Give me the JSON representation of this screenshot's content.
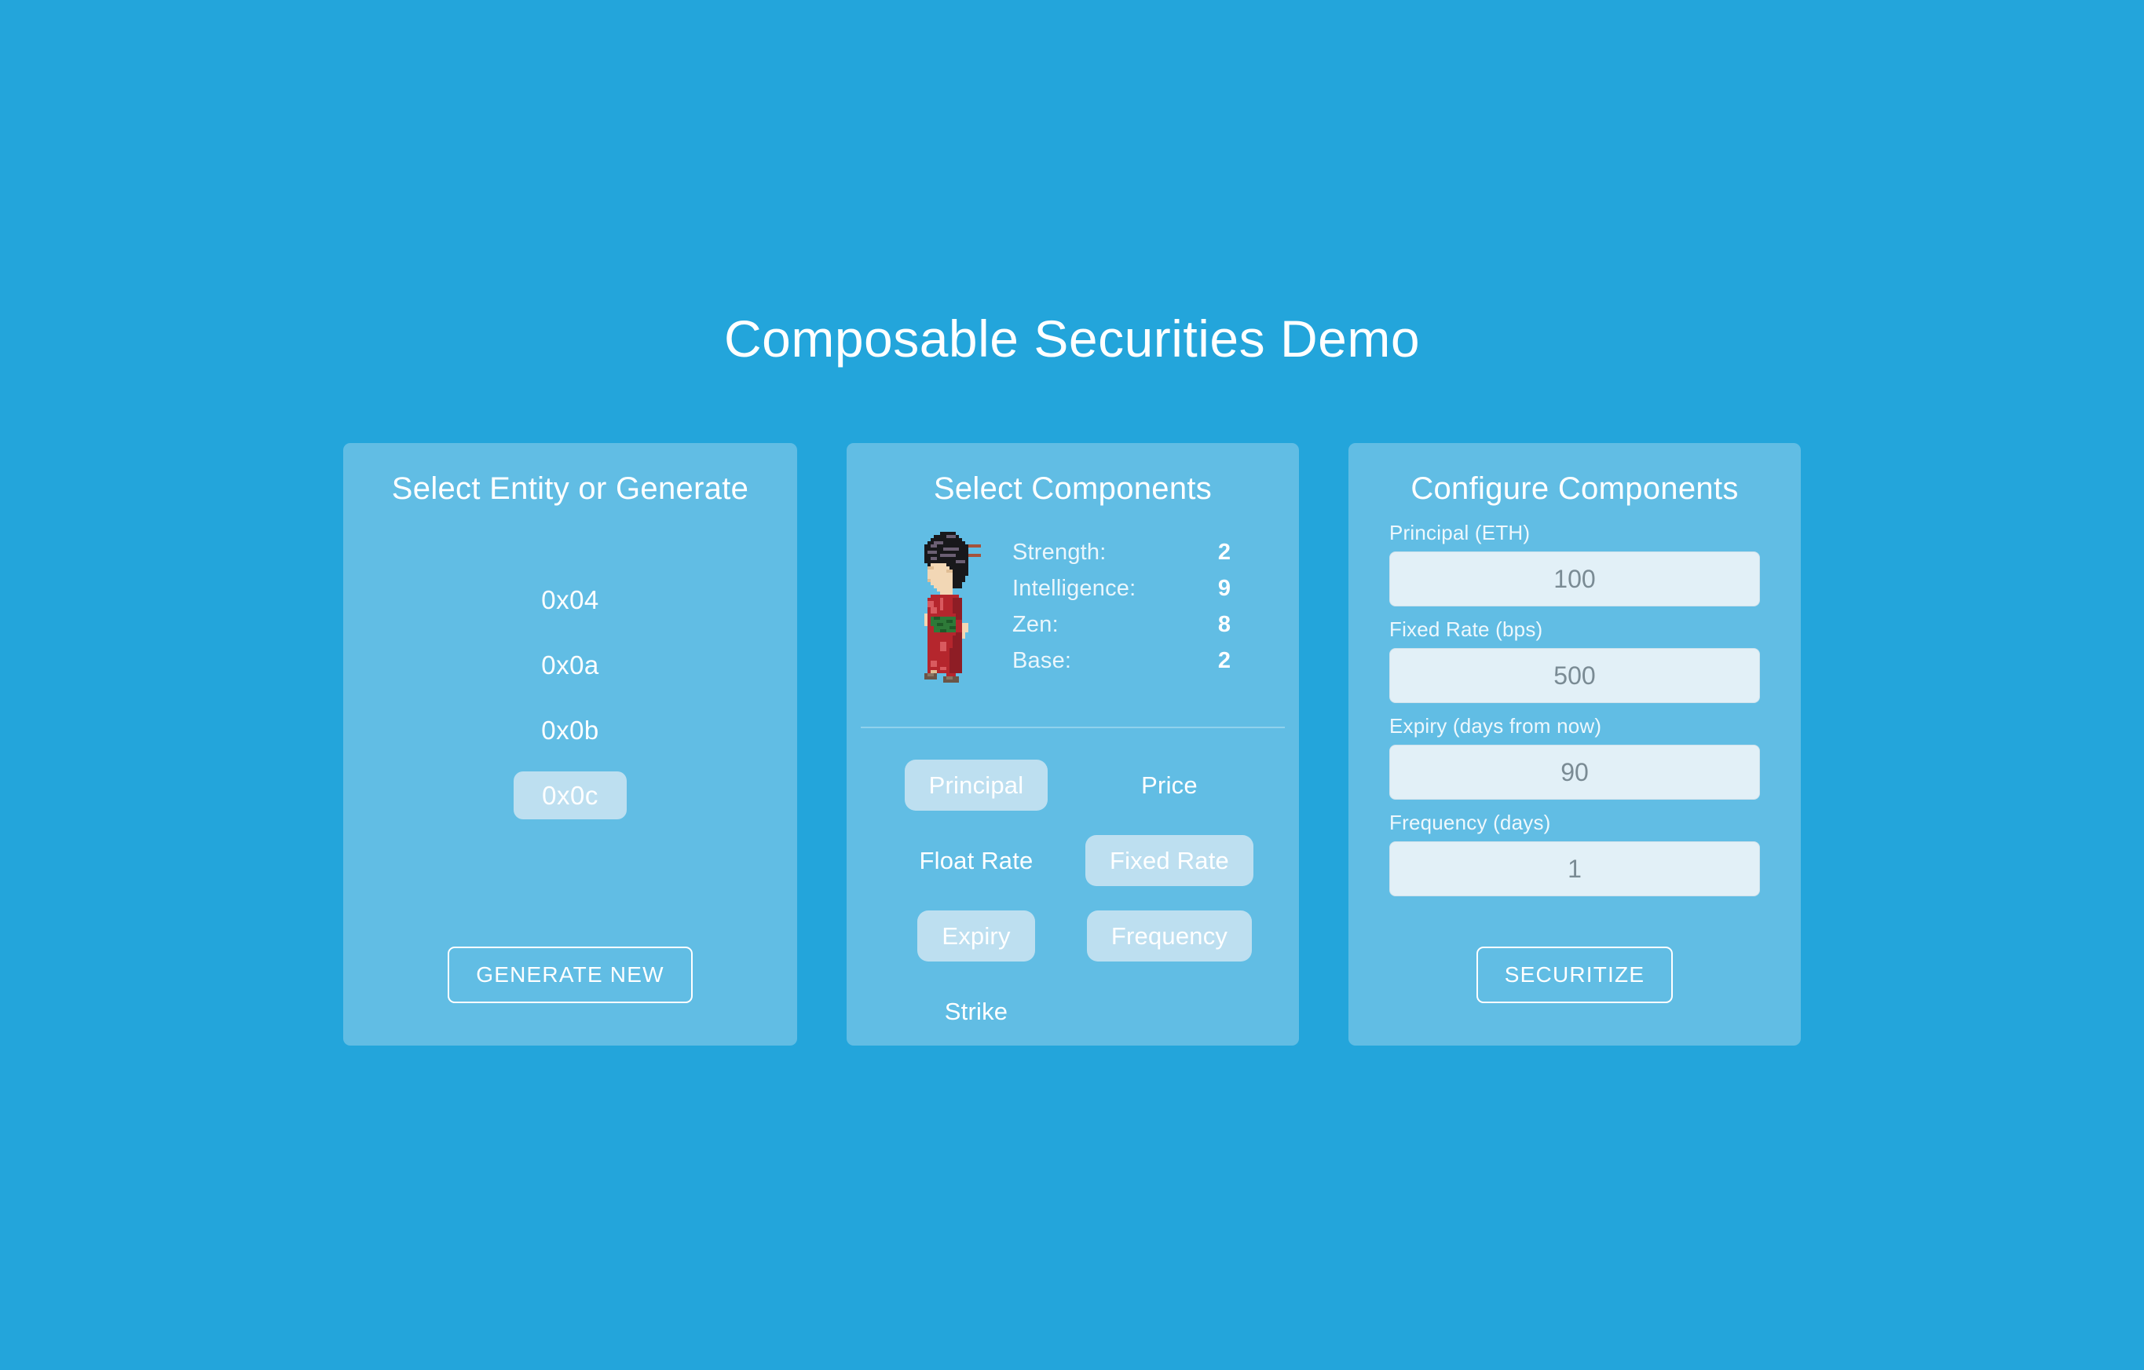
{
  "app": {
    "title": "Composable Securities Demo",
    "background_color": "#23a5db",
    "panel_color": "#61bde4",
    "selected_chip_color": "#bddff0",
    "input_background_color": "#e2f0f7",
    "input_text_color": "#7a8b94",
    "text_color": "#ffffff"
  },
  "panel_entity": {
    "title": "Select Entity or Generate",
    "items": [
      {
        "label": "0x04",
        "selected": false
      },
      {
        "label": "0x0a",
        "selected": false
      },
      {
        "label": "0x0b",
        "selected": false
      },
      {
        "label": "0x0c",
        "selected": true
      }
    ],
    "generate_button": "GENERATE NEW"
  },
  "panel_components": {
    "title": "Select Components",
    "sprite": {
      "icon_name": "pixel-character-kimono-sprite",
      "description": "Pixel-art woman in red kimono with black hair, wooden hairpins and green obi sash",
      "colors": {
        "hair": "#18181b",
        "hair_highlight": "#6b5f73",
        "hairpin": "#a5523a",
        "skin": "#f2d7b5",
        "skin_shadow": "#e0bd94",
        "kimono": "#b5262d",
        "kimono_shadow": "#8e1d25",
        "kimono_highlight": "#d95a5f",
        "obi": "#2e7a38",
        "obi_dark": "#1f5a28",
        "shoe": "#6b5547"
      }
    },
    "stats": [
      {
        "label": "Strength:",
        "value": "2"
      },
      {
        "label": "Intelligence:",
        "value": "9"
      },
      {
        "label": "Zen:",
        "value": "8"
      },
      {
        "label": "Base:",
        "value": "2"
      }
    ],
    "chips": [
      {
        "label": "Principal",
        "selected": true
      },
      {
        "label": "Price",
        "selected": false
      },
      {
        "label": "Float Rate",
        "selected": false
      },
      {
        "label": "Fixed Rate",
        "selected": true
      },
      {
        "label": "Expiry",
        "selected": true
      },
      {
        "label": "Frequency",
        "selected": true
      },
      {
        "label": "Strike",
        "selected": false
      }
    ]
  },
  "panel_configure": {
    "title": "Configure Components",
    "fields": [
      {
        "label": "Principal (ETH)",
        "value": "100",
        "placeholder": "100"
      },
      {
        "label": "Fixed Rate (bps)",
        "value": "500",
        "placeholder": "500"
      },
      {
        "label": "Expiry (days from now)",
        "value": "90",
        "placeholder": "90"
      },
      {
        "label": "Frequency (days)",
        "value": "1",
        "placeholder": "1"
      }
    ],
    "securitize_button": "SECURITIZE"
  }
}
